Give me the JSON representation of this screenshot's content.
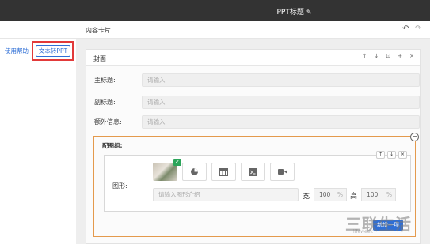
{
  "topbar": {
    "title": "PPT标题",
    "edit_icon": "pencil-icon"
  },
  "subbar": {
    "label": "内容卡片",
    "undo_icon": "undo-icon",
    "redo_icon": "redo-icon"
  },
  "left": {
    "help_link": "使用帮助",
    "text_to_ppt": "文本转PPT"
  },
  "card": {
    "title": "封面",
    "tools": [
      "↑",
      "↓",
      "⊡",
      "+",
      "×"
    ],
    "fields": [
      {
        "label": "主标题:",
        "placeholder": "请输入"
      },
      {
        "label": "副标题:",
        "placeholder": "请输入"
      },
      {
        "label": "额外信息:",
        "placeholder": "请输入"
      }
    ]
  },
  "group": {
    "title": "配图组:",
    "arrows": [
      "↑",
      "↓",
      "×"
    ],
    "shape_label": "图形:",
    "shape_types": [
      "image",
      "pie-chart",
      "table",
      "terminal",
      "video"
    ],
    "intro_placeholder": "请输入图形介绍",
    "width_label": "宽",
    "width_value": "100",
    "height_label": "高",
    "height_value": "100",
    "percent": "%",
    "add_button": "新增一项"
  },
  "watermark": {
    "text": "三联生活",
    "sub": "lifeweek"
  }
}
